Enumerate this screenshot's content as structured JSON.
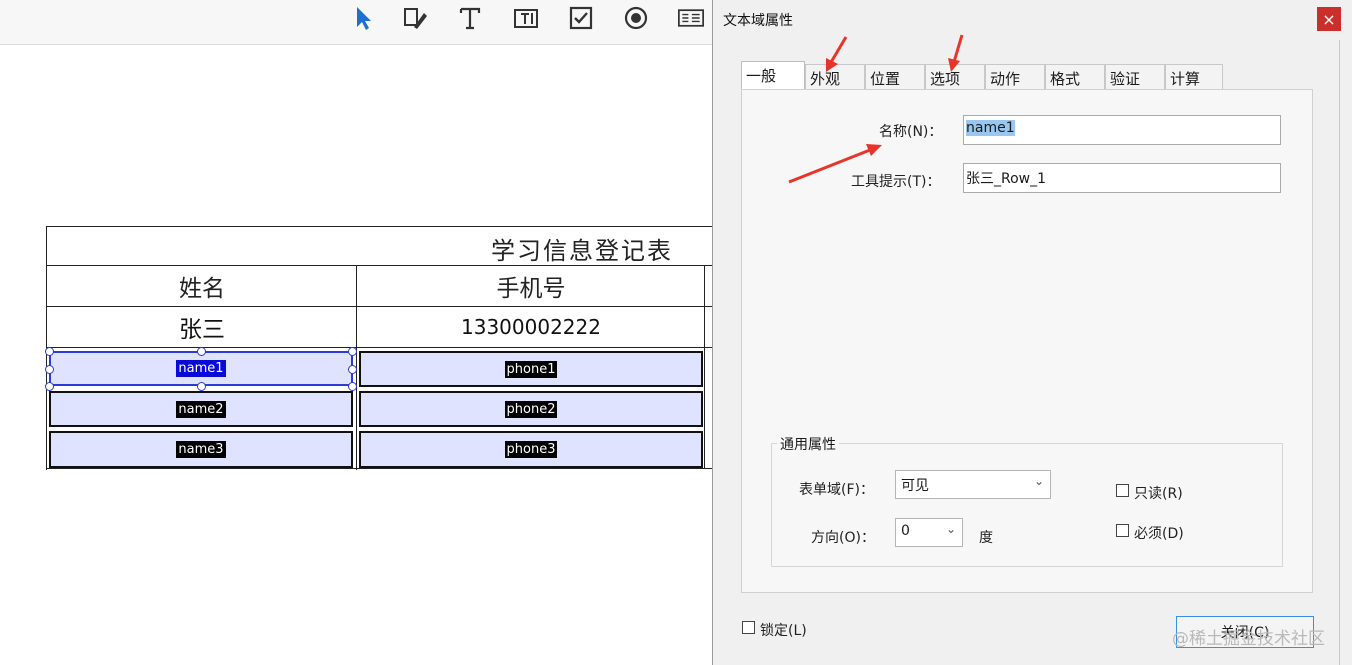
{
  "toolbar": {
    "tools": [
      {
        "icon": "select-arrow-icon"
      },
      {
        "icon": "edit-form-icon"
      },
      {
        "icon": "text-tool-icon"
      },
      {
        "icon": "text-field-icon"
      },
      {
        "icon": "checkbox-tool-icon"
      },
      {
        "icon": "radio-button-icon"
      },
      {
        "icon": "list-box-icon"
      }
    ]
  },
  "form": {
    "title": "学习信息登记表",
    "headers": [
      "姓名",
      "手机号"
    ],
    "row_values": [
      "张三",
      "13300002222"
    ],
    "fields": [
      [
        "name1",
        "phone1"
      ],
      [
        "name2",
        "phone2"
      ],
      [
        "name3",
        "phone3"
      ]
    ]
  },
  "dialog": {
    "title": "文本域属性",
    "close_glyph": "×",
    "tabs": [
      "一般",
      "外观",
      "位置",
      "选项",
      "动作",
      "格式",
      "验证",
      "计算"
    ],
    "active_tab": "一般",
    "name_label": "名称(N)：",
    "name_value": "name1",
    "tooltip_label": "工具提示(T)：",
    "tooltip_value": "张三_Row_1",
    "common_title": "通用属性",
    "formfield_label": "表单域(F)：",
    "formfield_value": "可见",
    "orientation_label": "方向(O)：",
    "orientation_value": "0",
    "orientation_unit": "度",
    "readonly_label": "只读(R)",
    "required_label": "必须(D)",
    "locked_label": "锁定(L)",
    "close_button": "关闭(C)"
  },
  "watermark": "@稀土掘金技术社区",
  "colors": {
    "annotation_arrow": "#e8352b",
    "field_fill": "#dfe3ff",
    "selection": "#2a3bd8",
    "close_bg": "#c9302c"
  }
}
